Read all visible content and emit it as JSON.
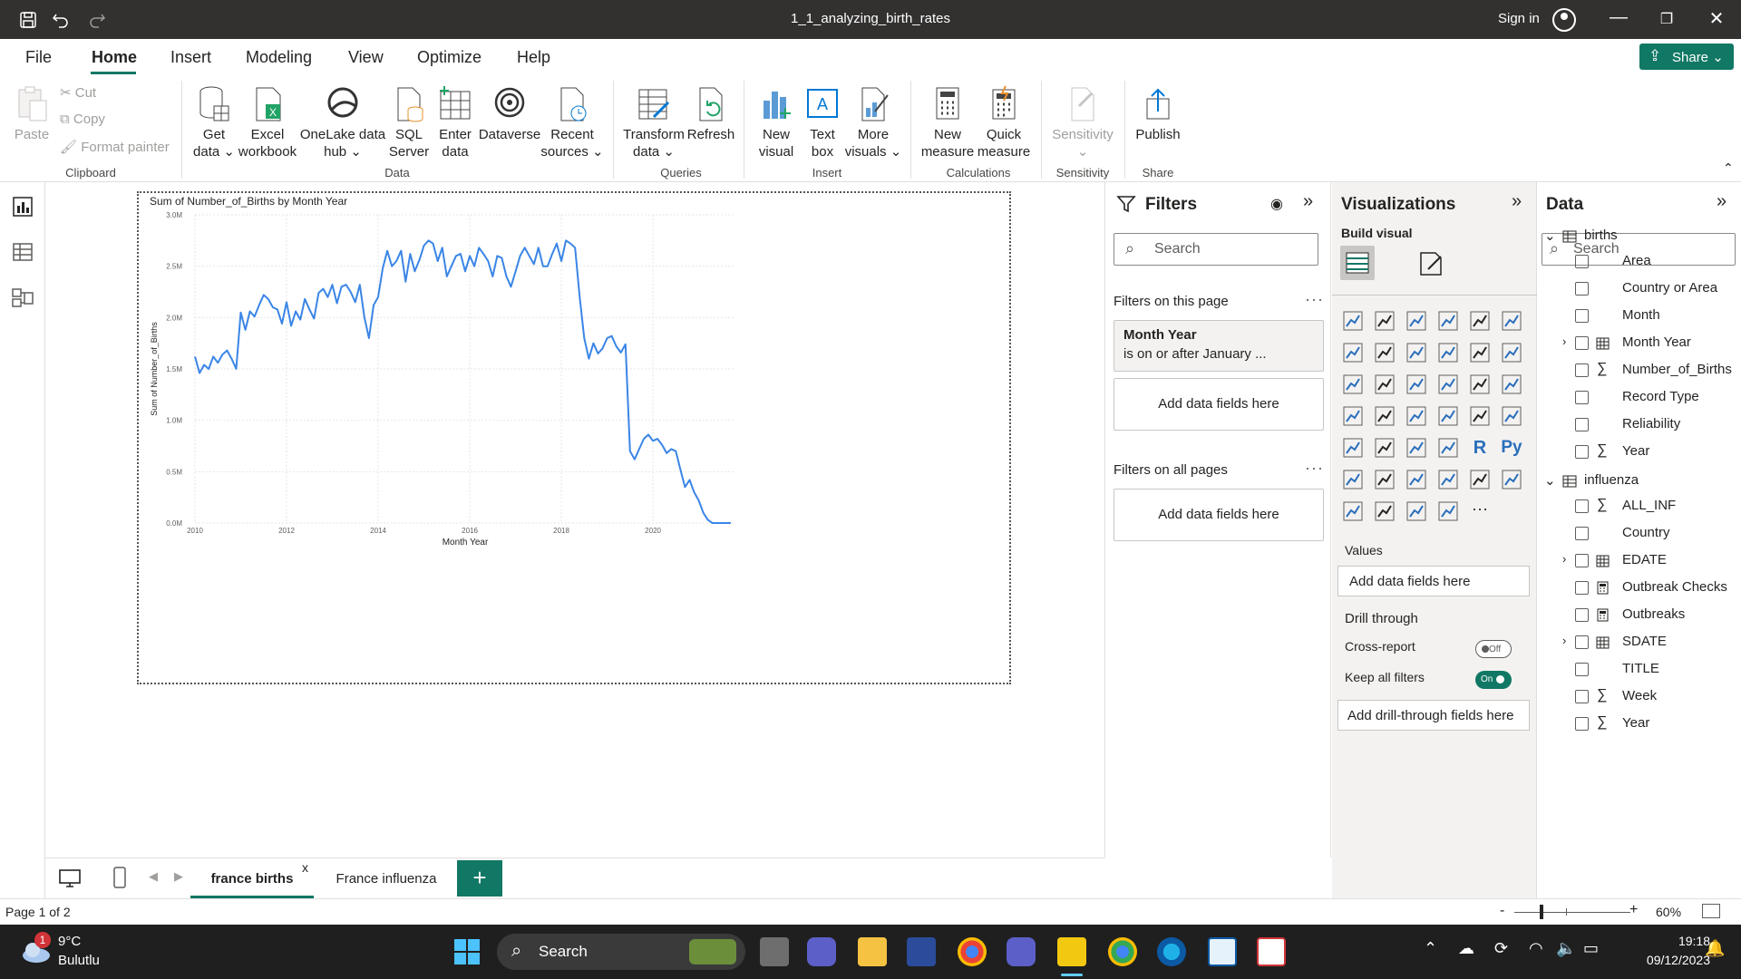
{
  "window": {
    "title": "1_1_analyzing_birth_rates",
    "signin": "Sign in"
  },
  "menu": {
    "tabs": [
      "File",
      "Home",
      "Insert",
      "Modeling",
      "View",
      "Optimize",
      "Help"
    ],
    "active": "Home",
    "share": "Share"
  },
  "ribbon": {
    "clipboard": {
      "paste": "Paste",
      "cut": "Cut",
      "copy": "Copy",
      "format_painter": "Format painter",
      "group": "Clipboard"
    },
    "data": {
      "get_data": [
        "Get",
        "data ⌄"
      ],
      "excel": [
        "Excel",
        "workbook"
      ],
      "onelake": [
        "OneLake data",
        "hub ⌄"
      ],
      "sql": [
        "SQL",
        "Server"
      ],
      "enter": [
        "Enter",
        "data"
      ],
      "dataverse": "Dataverse",
      "recent": [
        "Recent",
        "sources ⌄"
      ],
      "group": "Data"
    },
    "queries": {
      "transform": [
        "Transform",
        "data ⌄"
      ],
      "refresh": "Refresh",
      "group": "Queries"
    },
    "insert": {
      "new_visual": [
        "New",
        "visual"
      ],
      "text_box": [
        "Text",
        "box"
      ],
      "more": [
        "More",
        "visuals ⌄"
      ],
      "group": "Insert"
    },
    "calculations": {
      "new_measure": [
        "New",
        "measure"
      ],
      "quick_measure": [
        "Quick",
        "measure"
      ],
      "group": "Calculations"
    },
    "sensitivity": {
      "label": "Sensitivity",
      "group": "Sensitivity"
    },
    "share": {
      "publish": "Publish",
      "group": "Share"
    }
  },
  "chart_data": {
    "type": "line",
    "title": "Sum of Number_of_Births by Month Year",
    "xlabel": "Month Year",
    "ylabel": "Sum of Number_of_Births",
    "xlim": [
      2010,
      2021.8
    ],
    "ylim": [
      0,
      3000000
    ],
    "yticks": [
      "0.0M",
      "0.5M",
      "1.0M",
      "1.5M",
      "2.0M",
      "2.5M",
      "3.0M"
    ],
    "xticks": [
      "2010",
      "2012",
      "2014",
      "2016",
      "2018",
      "2020"
    ],
    "grid": true,
    "series": [
      {
        "color": "#3a85e6",
        "x": [
          2010.0,
          2010.1,
          2010.2,
          2010.3,
          2010.4,
          2010.5,
          2010.6,
          2010.7,
          2010.8,
          2010.9,
          2011.0,
          2011.1,
          2011.2,
          2011.3,
          2011.4,
          2011.5,
          2011.6,
          2011.7,
          2011.8,
          2011.9,
          2012.0,
          2012.1,
          2012.2,
          2012.3,
          2012.4,
          2012.5,
          2012.6,
          2012.7,
          2012.8,
          2012.9,
          2013.0,
          2013.1,
          2013.2,
          2013.3,
          2013.4,
          2013.5,
          2013.6,
          2013.7,
          2013.8,
          2013.9,
          2014.0,
          2014.1,
          2014.2,
          2014.3,
          2014.4,
          2014.5,
          2014.6,
          2014.7,
          2014.8,
          2014.9,
          2015.0,
          2015.1,
          2015.2,
          2015.3,
          2015.4,
          2015.5,
          2015.6,
          2015.7,
          2015.8,
          2015.9,
          2016.0,
          2016.1,
          2016.2,
          2016.3,
          2016.4,
          2016.5,
          2016.6,
          2016.7,
          2016.8,
          2016.9,
          2017.0,
          2017.1,
          2017.2,
          2017.3,
          2017.4,
          2017.5,
          2017.6,
          2017.7,
          2017.8,
          2017.9,
          2018.0,
          2018.1,
          2018.2,
          2018.3,
          2018.4,
          2018.5,
          2018.6,
          2018.7,
          2018.8,
          2018.9,
          2019.0,
          2019.1,
          2019.2,
          2019.3,
          2019.4,
          2019.5,
          2019.6,
          2019.7,
          2019.8,
          2019.9,
          2020.0,
          2020.1,
          2020.2,
          2020.3,
          2020.4,
          2020.5,
          2020.6,
          2020.7,
          2020.8,
          2020.9,
          2021.0,
          2021.1,
          2021.2,
          2021.3,
          2021.4,
          2021.5,
          2021.6,
          2021.7
        ],
        "values": [
          1620000,
          1460000,
          1540000,
          1500000,
          1620000,
          1560000,
          1640000,
          1680000,
          1600000,
          1500000,
          2050000,
          1880000,
          2060000,
          2010000,
          2120000,
          2220000,
          2180000,
          2100000,
          2080000,
          1940000,
          2150000,
          1920000,
          2060000,
          1980000,
          2180000,
          2080000,
          1990000,
          2240000,
          2280000,
          2200000,
          2320000,
          2140000,
          2300000,
          2320000,
          2250000,
          2150000,
          2320000,
          2000000,
          1800000,
          2120000,
          2200000,
          2480000,
          2650000,
          2500000,
          2550000,
          2650000,
          2350000,
          2620000,
          2450000,
          2560000,
          2700000,
          2750000,
          2720000,
          2550000,
          2680000,
          2400000,
          2500000,
          2600000,
          2620000,
          2450000,
          2600000,
          2500000,
          2680000,
          2620000,
          2550000,
          2400000,
          2600000,
          2580000,
          2400000,
          2300000,
          2450000,
          2600000,
          2680000,
          2600000,
          2520000,
          2680000,
          2500000,
          2500000,
          2620000,
          2720000,
          2550000,
          2750000,
          2720000,
          2680000,
          2200000,
          1800000,
          1600000,
          1750000,
          1650000,
          1700000,
          1800000,
          1820000,
          1720000,
          1660000,
          1740000,
          700000,
          620000,
          720000,
          820000,
          860000,
          800000,
          820000,
          760000,
          680000,
          720000,
          700000,
          520000,
          350000,
          420000,
          300000,
          220000,
          100000,
          30000,
          0,
          0,
          0,
          0,
          0
        ]
      }
    ]
  },
  "filters": {
    "title": "Filters",
    "search": "Search",
    "on_page": "Filters on this page",
    "card_title": "Month Year",
    "card_sub": "is on or after January ...",
    "add": "Add data fields here",
    "all_pages": "Filters on all pages",
    "add2": "Add data fields here"
  },
  "visualizations": {
    "title": "Visualizations",
    "build": "Build visual",
    "values": "Values",
    "values_add": "Add data fields here",
    "drill": "Drill through",
    "cross": "Cross-report",
    "cross_state": "Off",
    "keep": "Keep all filters",
    "keep_state": "On",
    "drill_add": "Add drill-through fields here"
  },
  "data_pane": {
    "title": "Data",
    "search": "Search",
    "tables": [
      {
        "name": "births",
        "fields": [
          {
            "label": "Area",
            "icon": "",
            "expand": false
          },
          {
            "label": "Country or Area",
            "icon": "",
            "expand": false
          },
          {
            "label": "Month",
            "icon": "",
            "expand": false
          },
          {
            "label": "Month Year",
            "icon": "calendar",
            "expand": true
          },
          {
            "label": "Number_of_Births",
            "icon": "sigma",
            "expand": false
          },
          {
            "label": "Record Type",
            "icon": "",
            "expand": false
          },
          {
            "label": "Reliability",
            "icon": "",
            "expand": false
          },
          {
            "label": "Year",
            "icon": "sigma",
            "expand": false
          }
        ]
      },
      {
        "name": "influenza",
        "fields": [
          {
            "label": "ALL_INF",
            "icon": "sigma",
            "expand": false
          },
          {
            "label": "Country",
            "icon": "",
            "expand": false
          },
          {
            "label": "EDATE",
            "icon": "calendar",
            "expand": true
          },
          {
            "label": "Outbreak Checks",
            "icon": "calc",
            "expand": false
          },
          {
            "label": "Outbreaks",
            "icon": "calc",
            "expand": false
          },
          {
            "label": "SDATE",
            "icon": "calendar",
            "expand": true
          },
          {
            "label": "TITLE",
            "icon": "",
            "expand": false
          },
          {
            "label": "Week",
            "icon": "sigma",
            "expand": false
          },
          {
            "label": "Year",
            "icon": "sigma",
            "expand": false
          }
        ]
      }
    ]
  },
  "pages": {
    "tabs": [
      "france births",
      "France influenza"
    ],
    "active": 0,
    "close": "x",
    "add": "+"
  },
  "status": {
    "page": "Page 1 of 2",
    "zoom": "60%",
    "minus": "-",
    "plus": "+"
  },
  "taskbar": {
    "temp": "9°C",
    "weather": "Bulutlu",
    "badge": "1",
    "search": "Search",
    "time": "19:18",
    "date": "09/12/2023"
  }
}
